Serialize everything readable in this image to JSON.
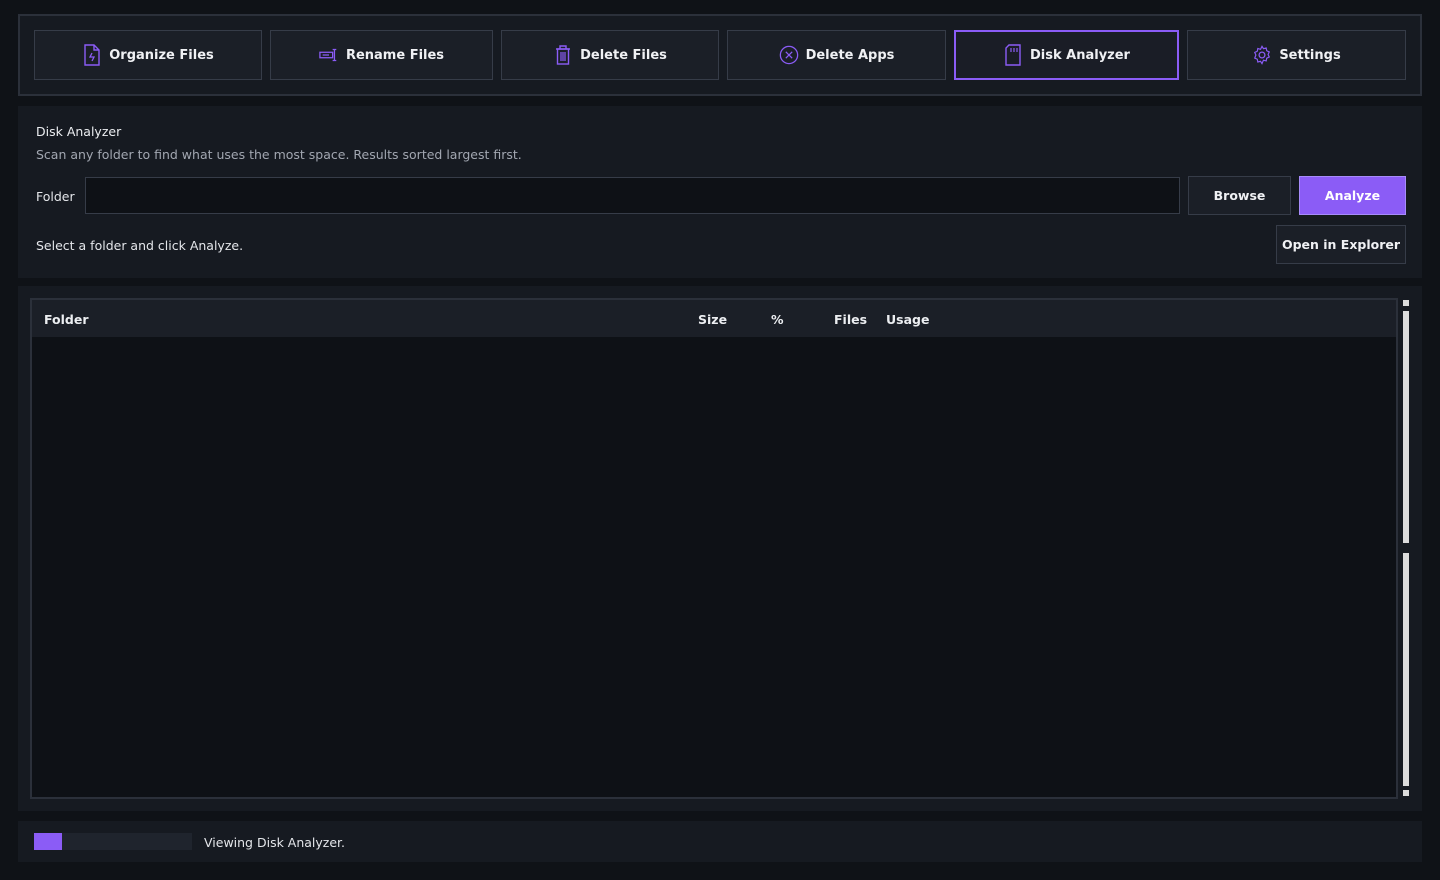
{
  "colors": {
    "accent": "#8b5cf6",
    "background": "#0f1217",
    "panel": "#161a21",
    "border": "#363c48"
  },
  "tabs": [
    {
      "label": "Organize Files",
      "icon": "file-organize-icon"
    },
    {
      "label": "Rename Files",
      "icon": "rename-icon"
    },
    {
      "label": "Delete Files",
      "icon": "trash-icon"
    },
    {
      "label": "Delete Apps",
      "icon": "circle-x-icon"
    },
    {
      "label": "Disk Analyzer",
      "icon": "sd-card-icon",
      "active": true
    },
    {
      "label": "Settings",
      "icon": "gear-icon"
    }
  ],
  "analyzer": {
    "title": "Disk Analyzer",
    "subtitle": "Scan any folder to find what uses the most space. Results sorted largest first.",
    "folder_label": "Folder",
    "folder_value": "",
    "browse_label": "Browse",
    "analyze_label": "Analyze",
    "hint": "Select a folder and click Analyze.",
    "open_explorer_label": "Open in Explorer"
  },
  "table": {
    "columns": [
      "Folder",
      "Size",
      "%",
      "Files",
      "Usage"
    ],
    "rows": []
  },
  "statusbar": {
    "progress_fraction": 0.18,
    "text": "Viewing Disk Analyzer."
  }
}
